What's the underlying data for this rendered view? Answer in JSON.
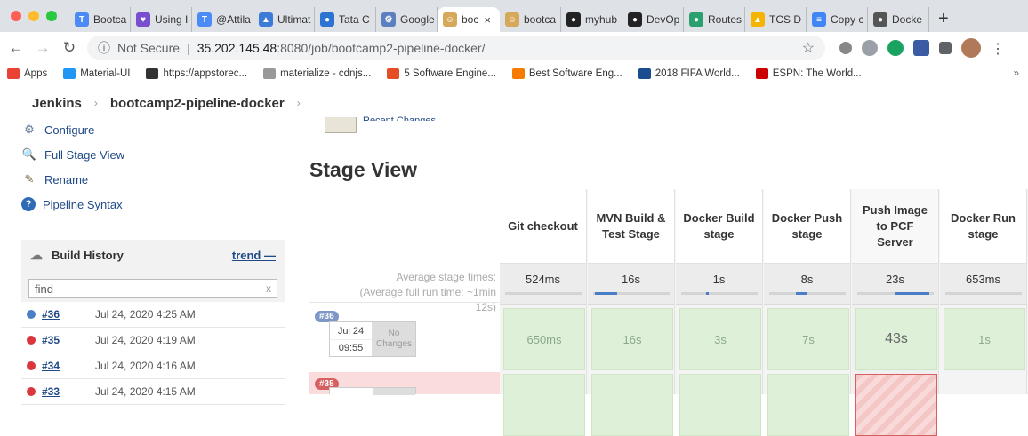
{
  "browser": {
    "tabs": [
      {
        "label": "Bootca",
        "icon": "T",
        "color": "#4c8bf5"
      },
      {
        "label": "Using I",
        "icon": "♥",
        "color": "#7a4fcf"
      },
      {
        "label": "@Attila",
        "icon": "T",
        "color": "#4c8bf5"
      },
      {
        "label": "Ultimat",
        "icon": "▲",
        "color": "#3d7bd8"
      },
      {
        "label": "Tata C",
        "icon": "●",
        "color": "#2c73d2"
      },
      {
        "label": "Google",
        "icon": "⚙",
        "color": "#5b7fbf"
      },
      {
        "label": "boc",
        "icon": "☺",
        "color": "#d6a85a",
        "active": true
      },
      {
        "label": "bootca",
        "icon": "☺",
        "color": "#d6a85a"
      },
      {
        "label": "myhub",
        "icon": "●",
        "color": "#222"
      },
      {
        "label": "DevOp",
        "icon": "●",
        "color": "#222"
      },
      {
        "label": "Routes",
        "icon": "●",
        "color": "#2aa06e"
      },
      {
        "label": "TCS D",
        "icon": "▲",
        "color": "#f4b400"
      },
      {
        "label": "Copy c",
        "icon": "≡",
        "color": "#4285f4"
      },
      {
        "label": "Docke",
        "icon": "●",
        "color": "#555"
      }
    ],
    "close_glyph": "×",
    "new_tab": "+",
    "address": {
      "security": "Not Secure",
      "host": "35.202.145.48",
      "path": ":8080/job/bootcamp2-pipeline-docker/"
    },
    "bookmarks": [
      {
        "label": "Apps",
        "color": "#e94235"
      },
      {
        "label": "Material-UI",
        "color": "#2196f3"
      },
      {
        "label": "https://appstorec...",
        "color": "#333"
      },
      {
        "label": "materialize - cdnjs...",
        "color": "#999"
      },
      {
        "label": "5 Software Engine...",
        "color": "#e44d26"
      },
      {
        "label": "Best Software Eng...",
        "color": "#f57c00"
      },
      {
        "label": "2018 FIFA World...",
        "color": "#1a4d8f"
      },
      {
        "label": "ESPN: The World...",
        "color": "#cc0000"
      }
    ],
    "bookmarks_more": "»"
  },
  "breadcrumb": {
    "root": "Jenkins",
    "job": "bootcamp2-pipeline-docker"
  },
  "sidebar": {
    "items": [
      {
        "label": "Configure",
        "icon": "gear-icon"
      },
      {
        "label": "Full Stage View",
        "icon": "magnifier-icon"
      },
      {
        "label": "Rename",
        "icon": "pencil-icon"
      },
      {
        "label": "Pipeline Syntax",
        "icon": "help-icon"
      }
    ]
  },
  "build_history": {
    "title": "Build History",
    "trend": "trend",
    "search_value": "find",
    "clear": "x",
    "builds": [
      {
        "number": "#36",
        "date": "Jul 24, 2020 4:25 AM",
        "status_color": "#4a7fc8"
      },
      {
        "number": "#35",
        "date": "Jul 24, 2020 4:19 AM",
        "status_color": "#d9363e"
      },
      {
        "number": "#34",
        "date": "Jul 24, 2020 4:16 AM",
        "status_color": "#d9363e"
      },
      {
        "number": "#33",
        "date": "Jul 24, 2020 4:15 AM",
        "status_color": "#d9363e"
      }
    ]
  },
  "main": {
    "recent_changes": "Recent Changes",
    "stage_view_title": "Stage View",
    "avg_line1": "Average stage times:",
    "avg_line2_prefix": "(Average ",
    "avg_line2_full": "full",
    "avg_line2_suffix": " run time: ~1min",
    "avg_line3": "12s)"
  },
  "stages": [
    {
      "name": "Git checkout",
      "avg": "524ms",
      "bar_fill": 0.0
    },
    {
      "name": "MVN Build & Test Stage",
      "avg": "16s",
      "bar_fill": 0.3
    },
    {
      "name": "Docker Build stage",
      "avg": "1s",
      "bar_fill": 0.02
    },
    {
      "name": "Docker Push stage",
      "avg": "8s",
      "bar_fill": 0.15
    },
    {
      "name": "Push Image to PCF Server",
      "avg": "23s",
      "bar_fill": 0.45
    },
    {
      "name": "Docker Run stage",
      "avg": "653ms",
      "bar_fill": 0.0
    }
  ],
  "runs": [
    {
      "badge": "#36",
      "date": "Jul 24",
      "time": "09:55",
      "changes_line1": "No",
      "changes_line2": "Changes",
      "durations": [
        "650ms",
        "16s",
        "3s",
        "7s",
        "43s",
        "1s"
      ]
    },
    {
      "badge": "#35",
      "durations": [
        "",
        "",
        "",
        "",
        "",
        ""
      ]
    }
  ],
  "colors": {
    "success_cell": "#dff0d8",
    "fail_cell": "#f4c6c6",
    "run_badge_success": "#7e97c7",
    "run_badge_fail": "#d65f5f"
  }
}
